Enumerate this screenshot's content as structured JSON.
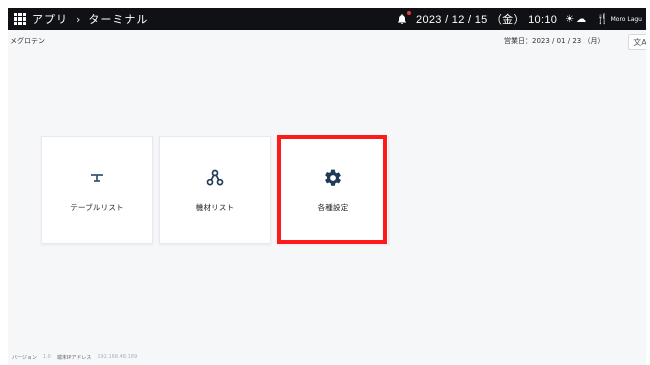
{
  "header": {
    "breadcrumb": [
      "アプリ",
      "ターミナル"
    ],
    "datetime": "2023 / 12 / 15 （金） 10:10",
    "weather": {
      "sun": "☀",
      "cloud": "☁"
    },
    "brand": "Moro Lagu"
  },
  "subheader": {
    "shop_name": "メグロテン",
    "business_day": "営業日：2023 / 01 / 23 （月）",
    "lang_label": "文A"
  },
  "cards": [
    {
      "label": "テーブルリスト",
      "icon": "table-icon"
    },
    {
      "label": "機材リスト",
      "icon": "device-network-icon"
    },
    {
      "label": "各種設定",
      "icon": "gear-icon"
    }
  ],
  "footer": {
    "version_label": "バージョン",
    "version_value": "1.0",
    "ip_label": "端末IPアドレス",
    "ip_value": "192.168.48.189"
  },
  "colors": {
    "topbar": "#0f1115",
    "highlight": "#ff1a1a",
    "background": "#f6f7f9"
  }
}
